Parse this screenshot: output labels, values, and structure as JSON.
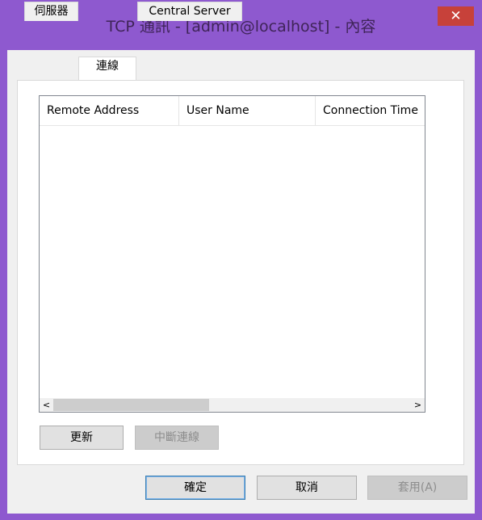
{
  "window": {
    "title": "TCP 通訊 - [admin@localhost] - 內容",
    "close_glyph": "✕"
  },
  "tabs": [
    {
      "label": "伺服器",
      "selected": false
    },
    {
      "label": "連線",
      "selected": true
    },
    {
      "label": "Central Server",
      "selected": false
    }
  ],
  "connections": {
    "columns": [
      "Remote Address",
      "User Name",
      "Connection Time"
    ],
    "rows": []
  },
  "scrollbar": {
    "left_glyph": "<",
    "right_glyph": ">"
  },
  "buttons": {
    "refresh": "更新",
    "disconnect": "中斷連線",
    "ok": "確定",
    "cancel": "取消",
    "apply": "套用(A)"
  },
  "colors": {
    "frame": "#8e59cf",
    "close": "#c7413a"
  }
}
